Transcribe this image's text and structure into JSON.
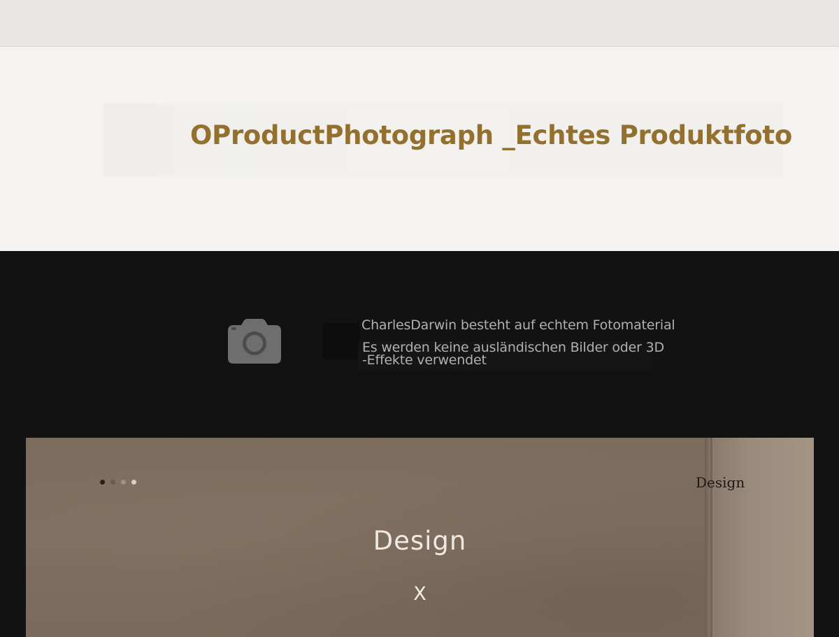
{
  "hero": {
    "title": "OProductPhotograph _Echtes Produktfoto"
  },
  "claims": {
    "icon": "camera-icon",
    "line1": "CharlesDarwin besteht auf echtem Fotomaterial",
    "line2a": "Es werden keine ausländischen Bilder oder 3D",
    "line2b": "-Effekte verwendet"
  },
  "banner": {
    "tag": "Design",
    "heading": "Design",
    "sub": "X",
    "dot_colors": [
      "#2a1f17",
      "#6a5a4d",
      "#a09082",
      "#d9d0c6"
    ]
  },
  "colors": {
    "title": "#94702f",
    "claim_text": "#b2b0ac",
    "dark_bg": "#121212",
    "light_bg": "#f4f3f1"
  }
}
